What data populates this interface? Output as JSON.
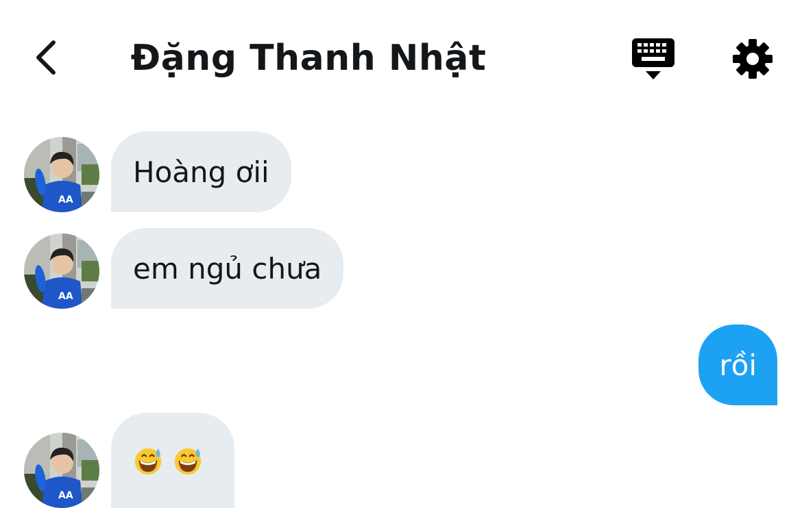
{
  "header": {
    "back_icon": "chevron-left-icon",
    "title": "Đặng Thanh Nhật",
    "keyboard_icon": "keyboard-icon",
    "settings_icon": "gear-icon"
  },
  "colors": {
    "incoming_bubble": "#e6ecf0",
    "outgoing_bubble": "#1da1f2",
    "text": "#14171a"
  },
  "messages": [
    {
      "direction": "incoming",
      "text": "Hoàng ơii"
    },
    {
      "direction": "incoming",
      "text": "em ngủ chưa"
    },
    {
      "direction": "outgoing",
      "text": "rồi"
    },
    {
      "direction": "incoming",
      "text": "",
      "emoji": [
        "grinning-face-with-sweat",
        "grinning-face-with-sweat"
      ]
    }
  ]
}
